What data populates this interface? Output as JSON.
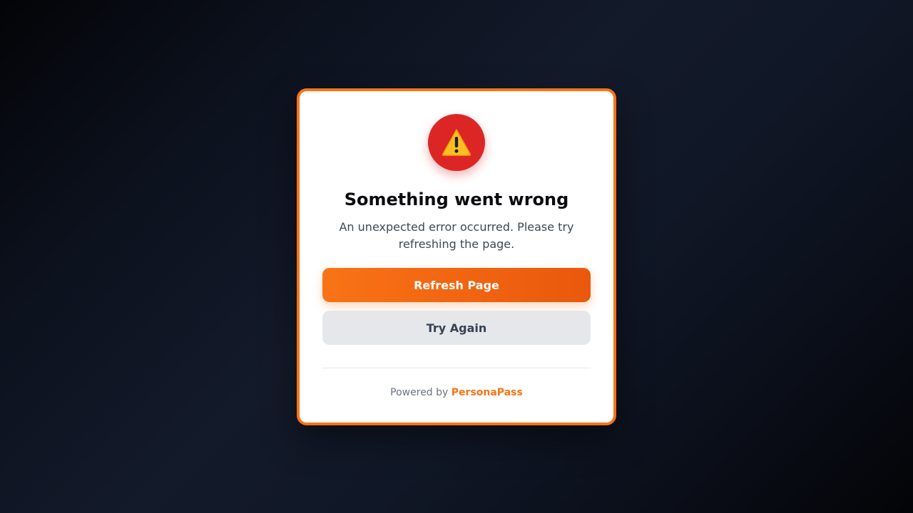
{
  "error": {
    "icon": "warning-icon",
    "title": "Something went wrong",
    "message": "An unexpected error occurred. Please try refreshing the page."
  },
  "actions": {
    "refresh_label": "Refresh Page",
    "retry_label": "Try Again"
  },
  "footer": {
    "prefix": "Powered by",
    "brand": "PersonaPass"
  },
  "colors": {
    "accent": "#f97316",
    "accent_dark": "#ea580c",
    "error": "#dc2626",
    "warning": "#fbbf24"
  }
}
